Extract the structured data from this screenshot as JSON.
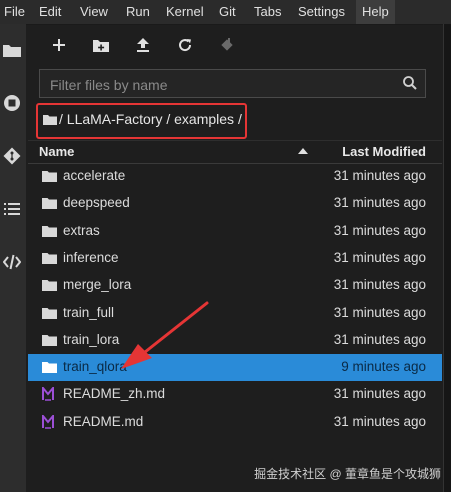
{
  "menu": [
    "File",
    "Edit",
    "View",
    "Run",
    "Kernel",
    "Git",
    "Tabs",
    "Settings",
    "Help"
  ],
  "filter": {
    "placeholder": "Filter files by name"
  },
  "breadcrumb": {
    "path": "/ LLaMA-Factory / examples /"
  },
  "header": {
    "name": "Name",
    "modified": "Last Modified"
  },
  "files": [
    {
      "name": "accelerate",
      "modified": "31 minutes ago",
      "type": "folder"
    },
    {
      "name": "deepspeed",
      "modified": "31 minutes ago",
      "type": "folder"
    },
    {
      "name": "extras",
      "modified": "31 minutes ago",
      "type": "folder"
    },
    {
      "name": "inference",
      "modified": "31 minutes ago",
      "type": "folder"
    },
    {
      "name": "merge_lora",
      "modified": "31 minutes ago",
      "type": "folder"
    },
    {
      "name": "train_full",
      "modified": "31 minutes ago",
      "type": "folder"
    },
    {
      "name": "train_lora",
      "modified": "31 minutes ago",
      "type": "folder"
    },
    {
      "name": "train_qlora",
      "modified": "9 minutes ago",
      "type": "folder",
      "selected": true
    },
    {
      "name": "README_zh.md",
      "modified": "31 minutes ago",
      "type": "markdown"
    },
    {
      "name": "README.md",
      "modified": "31 minutes ago",
      "type": "markdown"
    }
  ],
  "watermark": "掘金技术社区 @ 董章鱼是个攻城狮",
  "colors": {
    "selected": "#2a8bd8",
    "highlight_box": "#e53535",
    "markdown_icon": "#9c4fd6"
  }
}
